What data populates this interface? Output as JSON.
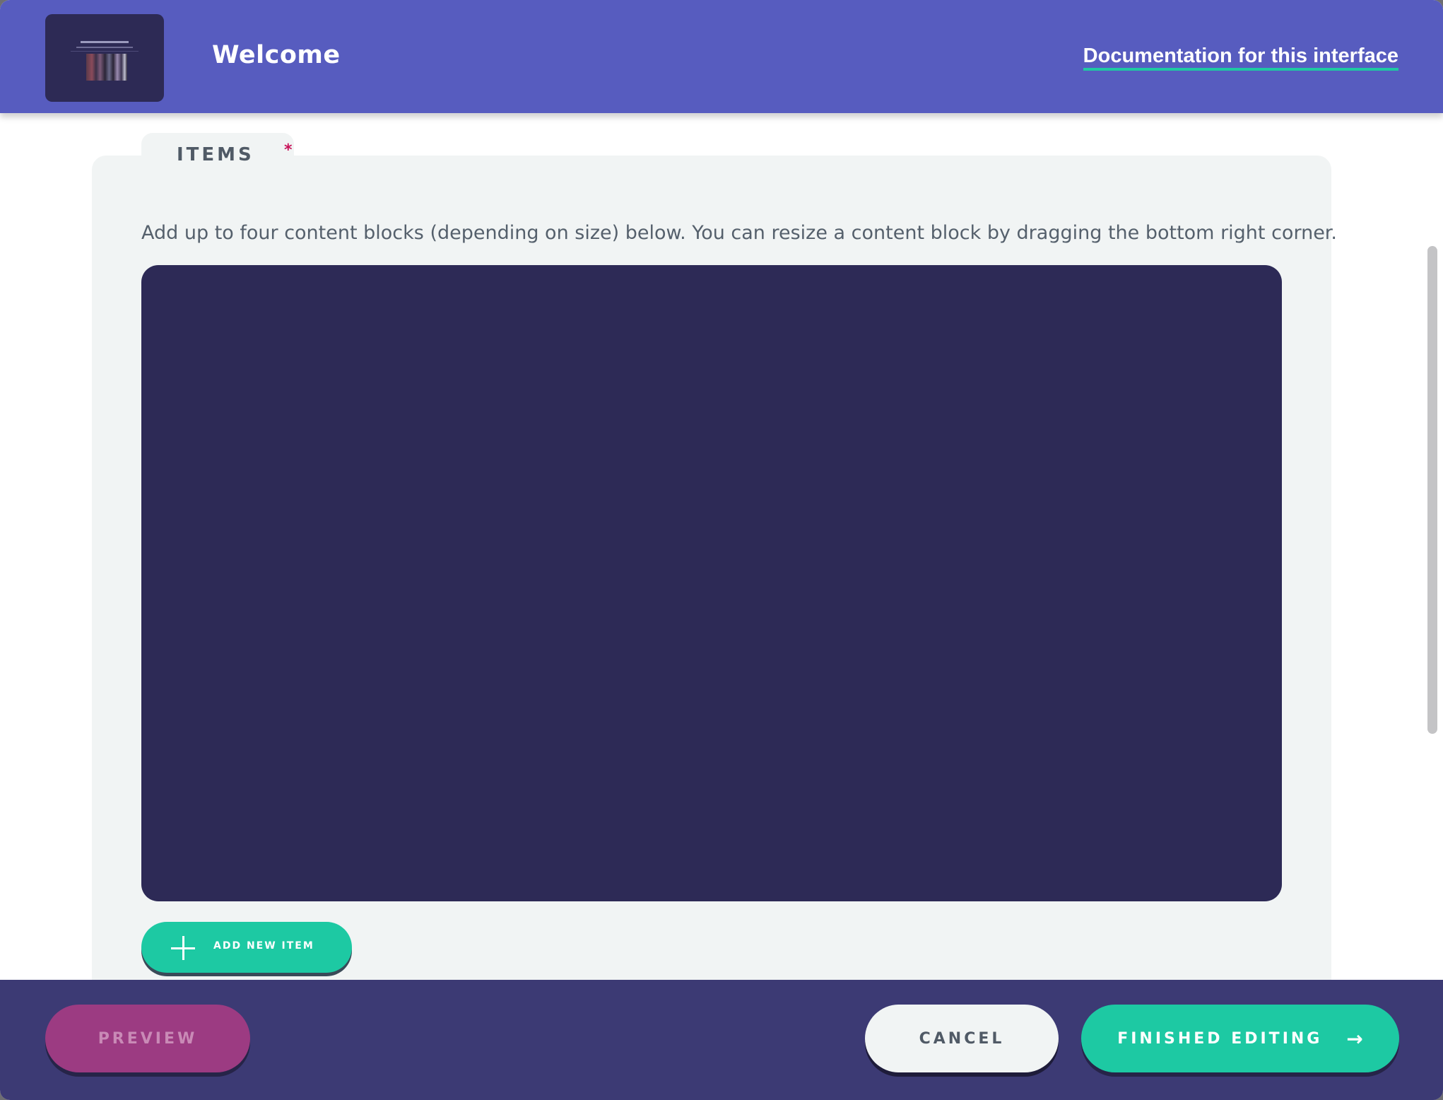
{
  "header": {
    "title": "Welcome",
    "doc_link": "Documentation for this interface"
  },
  "items_section": {
    "tab_label": "ITEMS",
    "required_marker": "*",
    "help_text": "Add up to four content blocks (depending on size) below. You can resize a content block by dragging the bottom right corner.",
    "add_button_label": "ADD NEW ITEM"
  },
  "footer": {
    "preview_label": "PREVIEW",
    "cancel_label": "CANCEL",
    "finish_label": "FINISHED EDITING",
    "finish_icon": "arrow-right-icon"
  },
  "colors": {
    "header_bg": "#575cbf",
    "footer_bg": "#3c3a74",
    "accent": "#1dc9a3",
    "preview": "#9c3b82",
    "content_block": "#2d2a56"
  }
}
